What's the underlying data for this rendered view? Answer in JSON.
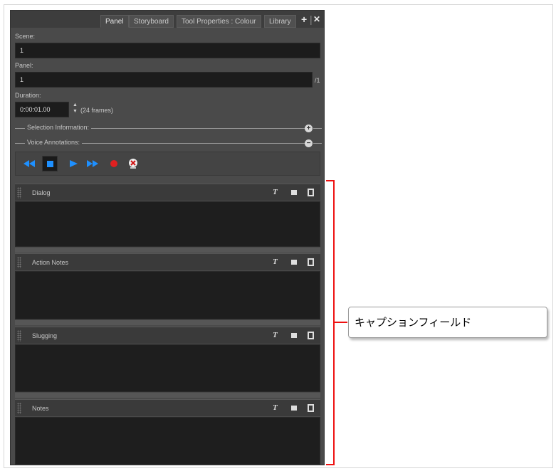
{
  "tabs": [
    "Panel",
    "Storyboard",
    "Tool Properties : Colour",
    "Library"
  ],
  "tab_controls": {
    "add": "+",
    "close": "✕"
  },
  "scene": {
    "label": "Scene:",
    "value": "1"
  },
  "panel_field": {
    "label": "Panel:",
    "value": "1",
    "total": "/1"
  },
  "duration": {
    "label": "Duration:",
    "value": "0:00:01.00",
    "frames": "(24 frames)"
  },
  "sections": {
    "selection": "Selection Information:",
    "voice": "Voice Annotations:"
  },
  "media_controls": [
    "rewind-icon",
    "stop-icon",
    "play-icon",
    "fast-forward-icon",
    "record-icon",
    "delete-recording-icon"
  ],
  "caption_fields": [
    {
      "title": "Dialog"
    },
    {
      "title": "Action Notes"
    },
    {
      "title": "Slugging"
    },
    {
      "title": "Notes"
    }
  ],
  "caption_icons": {
    "text": "T"
  },
  "callout": {
    "text": "キャプションフィールド"
  },
  "colors": {
    "bracket": "#ee1111",
    "panel_bg": "#4a4a4a",
    "field_bg": "#1e1e1e",
    "media_blue": "#1e90ff",
    "record_red": "#e02020"
  }
}
